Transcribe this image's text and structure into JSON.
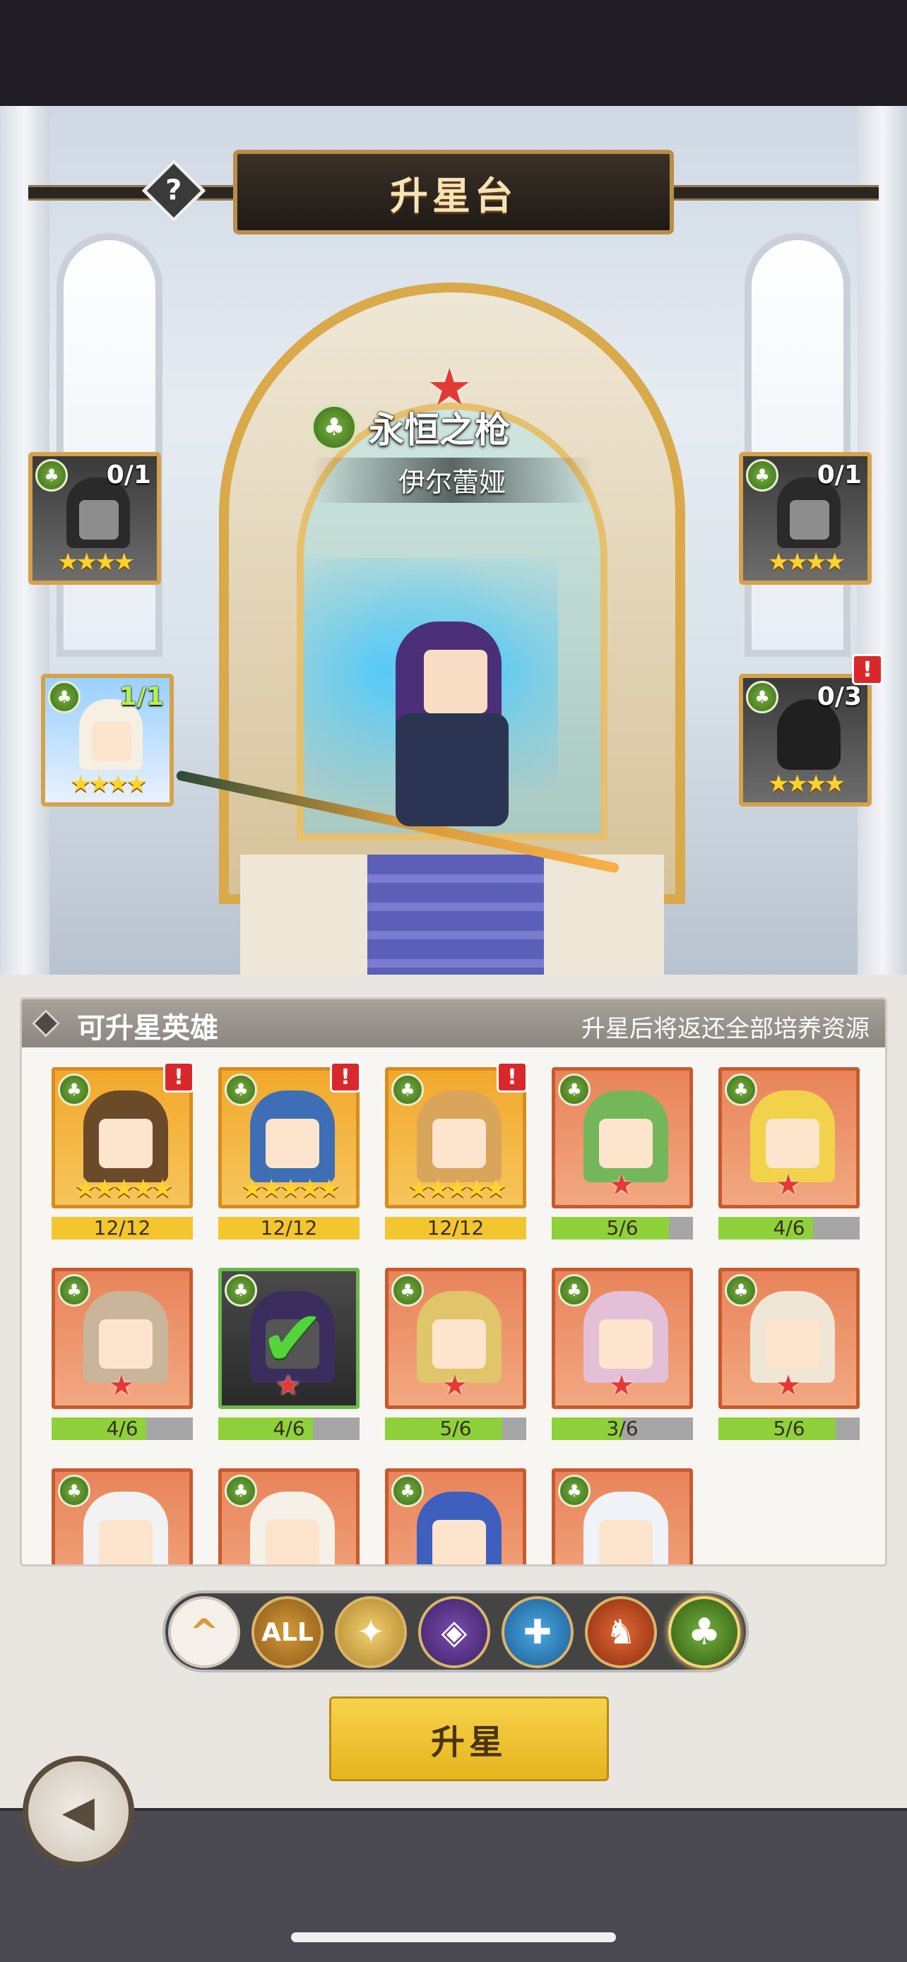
{
  "header": {
    "title": "升星台",
    "help_icon": "?"
  },
  "hero": {
    "star_icon": "★",
    "name": "永恒之枪",
    "subtitle": "伊尔蕾娅",
    "class_icon": "nature-tree-icon"
  },
  "materials": [
    {
      "count": "0/1",
      "stars": "★★★★",
      "filled": false,
      "alert": false
    },
    {
      "count": "0/1",
      "stars": "★★★★",
      "filled": false,
      "alert": false
    },
    {
      "count": "1/1",
      "stars": "★★★★",
      "filled": true,
      "alert": false
    },
    {
      "count": "0/3",
      "stars": "★★★★",
      "filled": false,
      "alert": true
    }
  ],
  "list": {
    "title": "可升星英雄",
    "note": "升星后将返还全部培养资源",
    "heroes": [
      {
        "progress": "12/12",
        "fraction": 1.0,
        "rarity": "gold",
        "stars": "★★★★★",
        "alert": true
      },
      {
        "progress": "12/12",
        "fraction": 1.0,
        "rarity": "gold",
        "stars": "★★★★★",
        "alert": true
      },
      {
        "progress": "12/12",
        "fraction": 1.0,
        "rarity": "gold",
        "stars": "★★★★★",
        "alert": true
      },
      {
        "progress": "5/6",
        "fraction": 0.83,
        "rarity": "red",
        "stars": "★"
      },
      {
        "progress": "4/6",
        "fraction": 0.67,
        "rarity": "red",
        "stars": "★"
      },
      {
        "progress": "4/6",
        "fraction": 0.67,
        "rarity": "red",
        "stars": "★"
      },
      {
        "progress": "4/6",
        "fraction": 0.67,
        "rarity": "selected",
        "stars": "★",
        "selected": true
      },
      {
        "progress": "5/6",
        "fraction": 0.83,
        "rarity": "red",
        "stars": "★"
      },
      {
        "progress": "3/6",
        "fraction": 0.5,
        "rarity": "red",
        "stars": "★"
      },
      {
        "progress": "5/6",
        "fraction": 0.83,
        "rarity": "red",
        "stars": "★"
      },
      {
        "rarity": "red"
      },
      {
        "rarity": "red"
      },
      {
        "rarity": "red"
      },
      {
        "rarity": "red"
      }
    ],
    "hair_colors": [
      "#6b4a2a",
      "#3e6fb6",
      "#d8a55b",
      "#74b65a",
      "#f2d24a",
      "#c9b59a",
      "#3b2d5e",
      "#e0c56a",
      "#e3c0d8",
      "#efe6d6",
      "#f2f2f2",
      "#f5f0e8",
      "#3f5fbf",
      "#f0f4f8"
    ]
  },
  "filters": [
    {
      "label": "^",
      "icon": "collapse-arrow-icon"
    },
    {
      "label": "ALL",
      "icon": "all-filter-icon"
    },
    {
      "label": "✦",
      "icon": "light-element-icon"
    },
    {
      "label": "◈",
      "icon": "dark-element-icon"
    },
    {
      "label": "✚",
      "icon": "water-element-icon"
    },
    {
      "label": "♞",
      "icon": "fire-element-icon"
    },
    {
      "label": "♣",
      "icon": "nature-element-icon"
    }
  ],
  "actions": {
    "upgrade_label": "升星",
    "back_icon": "◀"
  }
}
